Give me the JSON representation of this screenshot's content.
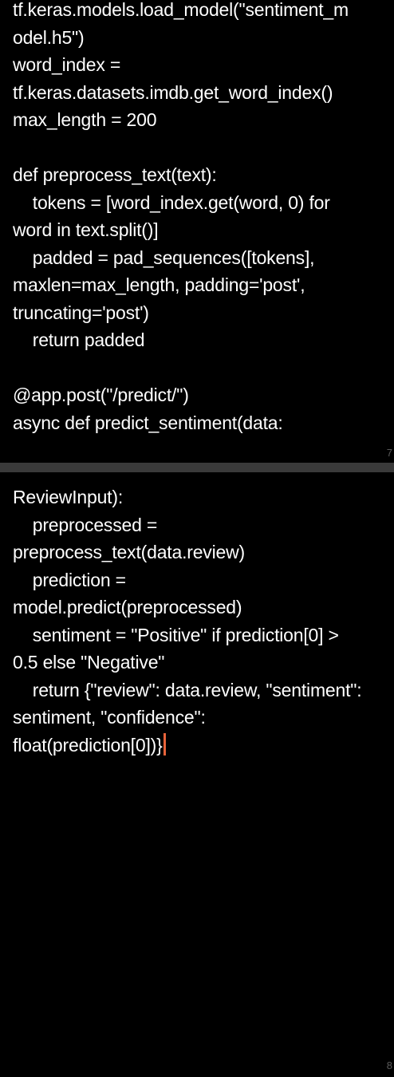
{
  "pages": [
    {
      "number": "7",
      "code": "tf.keras.models.load_model(\"sentiment_m\nodel.h5\")\nword_index =\ntf.keras.datasets.imdb.get_word_index()\nmax_length = 200\n\ndef preprocess_text(text):\n    tokens = [word_index.get(word, 0) for\nword in text.split()]\n    padded = pad_sequences([tokens],\nmaxlen=max_length, padding='post',\ntruncating='post')\n    return padded\n\n@app.post(\"/predict/\")\nasync def predict_sentiment(data:"
    },
    {
      "number": "8",
      "code": "ReviewInput):\n    preprocessed =\npreprocess_text(data.review)\n    prediction =\nmodel.predict(preprocessed)\n    sentiment = \"Positive\" if prediction[0] >\n0.5 else \"Negative\"\n    return {\"review\": data.review, \"sentiment\":\nsentiment, \"confidence\":\nfloat(prediction[0])}"
    }
  ],
  "colors": {
    "background": "#000000",
    "text": "#ffffff",
    "divider": "#3a3a3a",
    "cursor": "#e8633a",
    "page_number": "#5a5a5a"
  }
}
